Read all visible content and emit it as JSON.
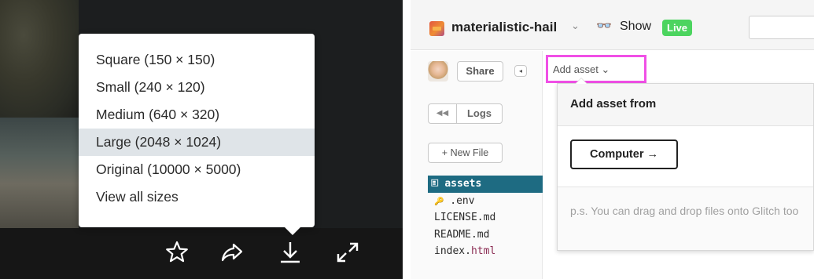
{
  "download_menu": {
    "items": [
      {
        "label": "Square (150 × 150)"
      },
      {
        "label": "Small (240 × 120)"
      },
      {
        "label": "Medium (640 × 320)"
      },
      {
        "label": "Large (2048 × 1024)",
        "selected": true
      },
      {
        "label": "Original (10000 × 5000)"
      },
      {
        "label": "View all sizes"
      }
    ]
  },
  "photo_toolbar": {
    "icons": [
      "star-icon",
      "share-arrow-icon",
      "download-icon",
      "expand-icon"
    ],
    "icon_color": "#ffffff"
  },
  "glitch": {
    "project_name": "materialistic-hail",
    "project_chevron": "⌄",
    "show_label": "Show",
    "show_glasses": "👓",
    "live_badge": "Live",
    "live_color": "#4cd45f",
    "share_label": "Share",
    "collapse_glyph": "◂",
    "logs_rewind": "◀◀",
    "logs_label": "Logs",
    "new_file_label": "+ New File",
    "files": {
      "folder_icon": "🗉",
      "folder": "assets",
      "env_icon": "🔑",
      "env": ".env",
      "license": "LICENSE.md",
      "readme": "README.md",
      "index_name": "index.",
      "index_ext": "html"
    },
    "add_asset_label": "Add asset ⌄",
    "highlight_color": "#f050e6",
    "popover": {
      "title": "Add asset from",
      "computer_button": "Computer →",
      "note": "p.s. You can drag and drop files onto Glitch too"
    },
    "folder_color": "#1e6b82"
  }
}
